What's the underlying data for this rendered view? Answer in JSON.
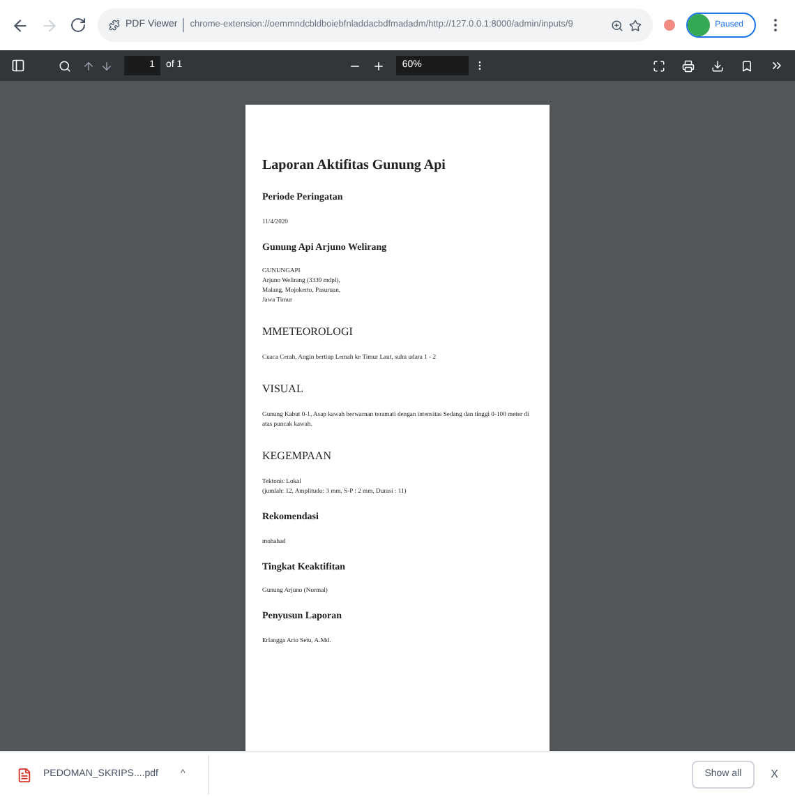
{
  "browser": {
    "site_label": "PDF Viewer",
    "url": "chrome-extension://oemmndcbldboiebfnladdacbdfmadadm/http://127.0.0.1:8000/admin/inputs/9",
    "profile": "Paused"
  },
  "pdf_toolbar": {
    "page": "1",
    "page_total": "of 1",
    "zoom": "60%"
  },
  "document": [
    {
      "kind": "title",
      "lines": [
        "Laporan Aktifitas Gunung Api"
      ]
    },
    {
      "kind": "heading",
      "lines": [
        "Periode Peringatan"
      ]
    },
    {
      "kind": "text",
      "lines": [
        "11/4/2020"
      ]
    },
    {
      "kind": "heading",
      "lines": [
        "Gunung Api Arjuno Welirang"
      ]
    },
    {
      "kind": "text",
      "lines": [
        "GUNUNGAPI",
        "Arjuno Welirang (3339 mdpl),",
        "Malang, Mojokerto, Pasuruan,",
        "Jawa Timur"
      ]
    },
    {
      "kind": "section",
      "lines": [
        "MMETEOROLOGI"
      ]
    },
    {
      "kind": "text",
      "lines": [
        "Cuaca Cerah, Angin bertiup Lemah ke Timur Laut, suhu udara 1 - 2"
      ]
    },
    {
      "kind": "section",
      "lines": [
        "VISUAL"
      ]
    },
    {
      "kind": "text",
      "lines": [
        "Gunung Kabut 0-1, Asap kawah berwarnan teramati dengan intensitas Sedang dan tinggi 0-100 meter di",
        "atas puncak kawah."
      ]
    },
    {
      "kind": "section",
      "lines": [
        "KEGEMPAAN"
      ]
    },
    {
      "kind": "text",
      "lines": [
        "Tektonic Lokal",
        "(jumlah: 12, Amplitudo: 3 mm, S-P : 2 mm, Durasi : 11)"
      ]
    },
    {
      "kind": "heading",
      "lines": [
        "Rekomendasi"
      ]
    },
    {
      "kind": "text",
      "lines": [
        "mohahad"
      ]
    },
    {
      "kind": "heading",
      "lines": [
        "Tingkat Keaktifitan"
      ]
    },
    {
      "kind": "text",
      "lines": [
        "Gunung Arjuno (Normal)"
      ]
    },
    {
      "kind": "heading",
      "lines": [
        "Penyusun Laporan"
      ]
    },
    {
      "kind": "text",
      "lines": [
        "Erlangga Ario Setu, A.Md."
      ]
    }
  ],
  "download_bar": {
    "file": "PEDOMAN_SKRIPS....pdf",
    "caret": "^",
    "show_all": "Show all",
    "close": "X"
  }
}
